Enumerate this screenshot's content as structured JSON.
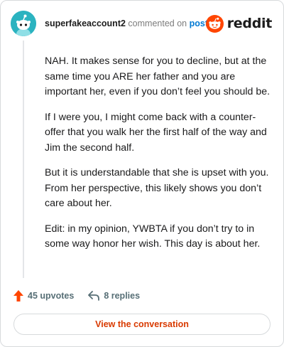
{
  "header": {
    "username": "superfakeaccount2",
    "action_text": "commented on",
    "post_link": "post",
    "brand_name": "reddit",
    "avatar_icon": "snoo-avatar-icon",
    "brand_icon": "reddit-logo-icon"
  },
  "comment": {
    "paragraphs": [
      "NAH. It makes sense for you to decline, but at the same time you ARE her father and you are important her, even if you don’t feel you should be.",
      "If I were you, I might come back with a counter-offer that you walk her the first half of the way and Jim the second half.",
      "But it is understandable that she is upset with you. From her perspective, this likely shows you don’t care about her.",
      "Edit: in my opinion, YWBTA if you don’t try to in some way honor her wish. This day is about her."
    ]
  },
  "stats": {
    "upvotes": "45 upvotes",
    "replies": "8 replies",
    "upvote_icon": "upvote-arrow-icon",
    "reply_icon": "reply-arrow-icon"
  },
  "cta": {
    "label": "View the conversation"
  },
  "colors": {
    "brand_orange": "#ff4500",
    "accent_orange": "#d93a00",
    "link_blue": "#0079d3",
    "avatar_teal": "#2bb3c0"
  }
}
